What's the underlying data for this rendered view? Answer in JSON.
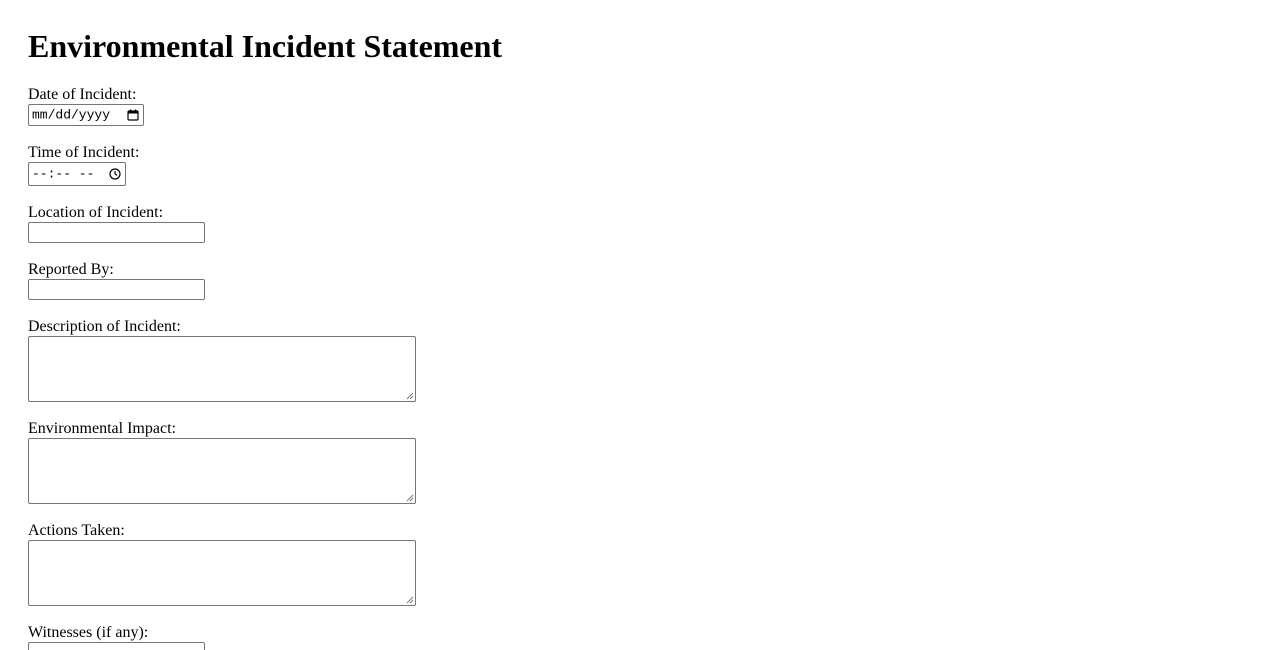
{
  "form": {
    "title": "Environmental Incident Statement",
    "date_label": "Date of Incident:",
    "date_placeholder": "mm/dd/yyyy",
    "time_label": "Time of Incident:",
    "time_placeholder": "--:-- --",
    "location_label": "Location of Incident:",
    "location_value": "",
    "reported_by_label": "Reported By:",
    "reported_by_value": "",
    "description_label": "Description of Incident:",
    "description_value": "",
    "impact_label": "Environmental Impact:",
    "impact_value": "",
    "actions_label": "Actions Taken:",
    "actions_value": "",
    "witnesses_label": "Witnesses (if any):",
    "witnesses_value": ""
  },
  "icons": {
    "date_picker": "calendar-icon",
    "time_picker": "clock-icon",
    "textarea_resize": "resize-grip-icon"
  }
}
